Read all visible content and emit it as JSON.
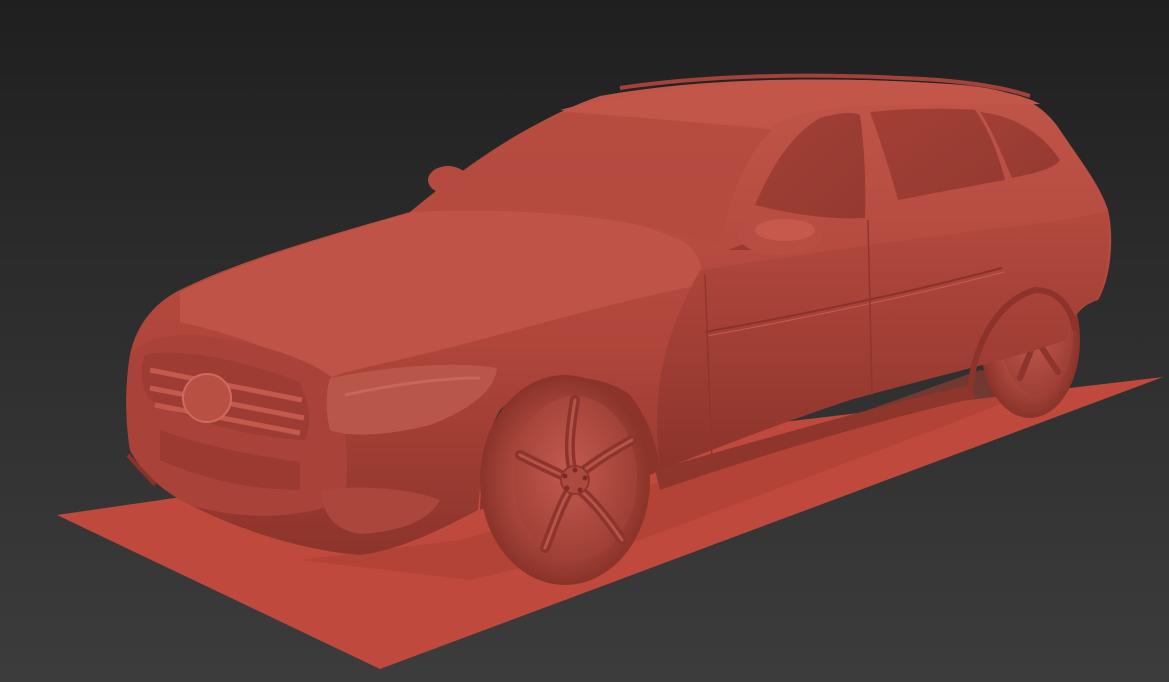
{
  "viewport": {
    "background_top": "#1f1f1f",
    "background_bottom": "#3c3c3c"
  },
  "scene": {
    "model": "station-wagon-car",
    "material_color": "#b5483c",
    "material_shadow": "#7a2c24",
    "material_highlight": "#c96153",
    "ground_plane_color": "#c0493d"
  }
}
